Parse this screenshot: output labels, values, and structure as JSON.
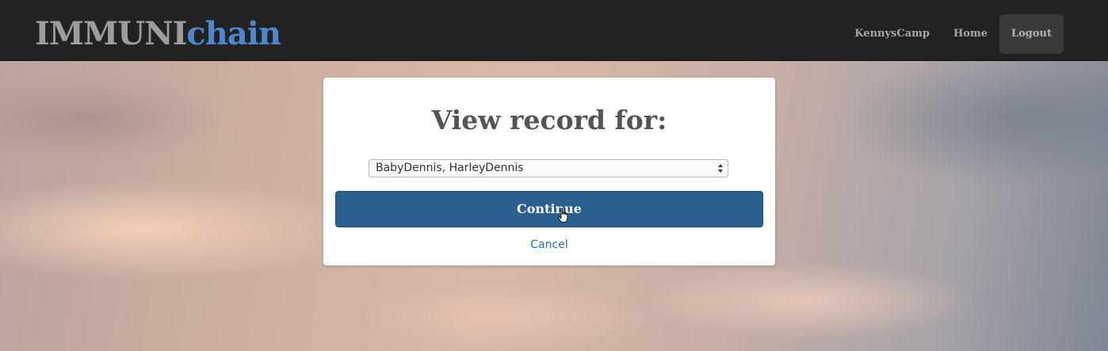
{
  "navbar": {
    "brand_part1": "IMMUNI",
    "brand_part2": "chain",
    "brand_color_gray": "#9d9d9d",
    "brand_color_blue": "#4f86d0",
    "links": [
      {
        "label": "KennysCamp"
      },
      {
        "label": "Home"
      },
      {
        "label": "Logout",
        "active": true
      }
    ]
  },
  "dialog": {
    "title": "View record for:",
    "select": {
      "selected_value": "BabyDennis, HarleyDennis"
    },
    "continue_label": "Continue",
    "cancel_label": "Cancel",
    "accent_color": "#2a6090"
  },
  "icons": {
    "select_arrows": "up-down-arrows-icon",
    "cursor": "hand-pointer-cursor-icon"
  }
}
